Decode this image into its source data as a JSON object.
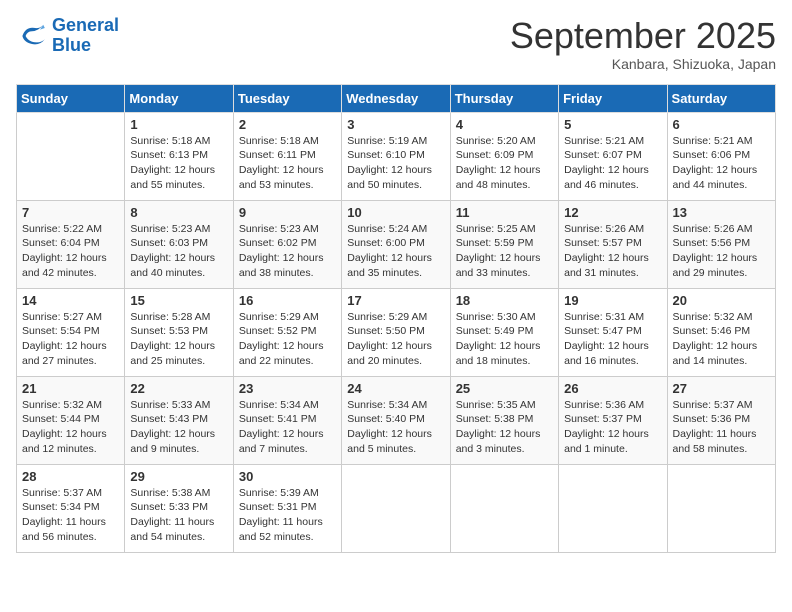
{
  "logo": {
    "text_general": "General",
    "text_blue": "Blue"
  },
  "header": {
    "month": "September 2025",
    "location": "Kanbara, Shizuoka, Japan"
  },
  "days_of_week": [
    "Sunday",
    "Monday",
    "Tuesday",
    "Wednesday",
    "Thursday",
    "Friday",
    "Saturday"
  ],
  "weeks": [
    [
      {
        "day": "",
        "info": ""
      },
      {
        "day": "1",
        "info": "Sunrise: 5:18 AM\nSunset: 6:13 PM\nDaylight: 12 hours\nand 55 minutes."
      },
      {
        "day": "2",
        "info": "Sunrise: 5:18 AM\nSunset: 6:11 PM\nDaylight: 12 hours\nand 53 minutes."
      },
      {
        "day": "3",
        "info": "Sunrise: 5:19 AM\nSunset: 6:10 PM\nDaylight: 12 hours\nand 50 minutes."
      },
      {
        "day": "4",
        "info": "Sunrise: 5:20 AM\nSunset: 6:09 PM\nDaylight: 12 hours\nand 48 minutes."
      },
      {
        "day": "5",
        "info": "Sunrise: 5:21 AM\nSunset: 6:07 PM\nDaylight: 12 hours\nand 46 minutes."
      },
      {
        "day": "6",
        "info": "Sunrise: 5:21 AM\nSunset: 6:06 PM\nDaylight: 12 hours\nand 44 minutes."
      }
    ],
    [
      {
        "day": "7",
        "info": "Sunrise: 5:22 AM\nSunset: 6:04 PM\nDaylight: 12 hours\nand 42 minutes."
      },
      {
        "day": "8",
        "info": "Sunrise: 5:23 AM\nSunset: 6:03 PM\nDaylight: 12 hours\nand 40 minutes."
      },
      {
        "day": "9",
        "info": "Sunrise: 5:23 AM\nSunset: 6:02 PM\nDaylight: 12 hours\nand 38 minutes."
      },
      {
        "day": "10",
        "info": "Sunrise: 5:24 AM\nSunset: 6:00 PM\nDaylight: 12 hours\nand 35 minutes."
      },
      {
        "day": "11",
        "info": "Sunrise: 5:25 AM\nSunset: 5:59 PM\nDaylight: 12 hours\nand 33 minutes."
      },
      {
        "day": "12",
        "info": "Sunrise: 5:26 AM\nSunset: 5:57 PM\nDaylight: 12 hours\nand 31 minutes."
      },
      {
        "day": "13",
        "info": "Sunrise: 5:26 AM\nSunset: 5:56 PM\nDaylight: 12 hours\nand 29 minutes."
      }
    ],
    [
      {
        "day": "14",
        "info": "Sunrise: 5:27 AM\nSunset: 5:54 PM\nDaylight: 12 hours\nand 27 minutes."
      },
      {
        "day": "15",
        "info": "Sunrise: 5:28 AM\nSunset: 5:53 PM\nDaylight: 12 hours\nand 25 minutes."
      },
      {
        "day": "16",
        "info": "Sunrise: 5:29 AM\nSunset: 5:52 PM\nDaylight: 12 hours\nand 22 minutes."
      },
      {
        "day": "17",
        "info": "Sunrise: 5:29 AM\nSunset: 5:50 PM\nDaylight: 12 hours\nand 20 minutes."
      },
      {
        "day": "18",
        "info": "Sunrise: 5:30 AM\nSunset: 5:49 PM\nDaylight: 12 hours\nand 18 minutes."
      },
      {
        "day": "19",
        "info": "Sunrise: 5:31 AM\nSunset: 5:47 PM\nDaylight: 12 hours\nand 16 minutes."
      },
      {
        "day": "20",
        "info": "Sunrise: 5:32 AM\nSunset: 5:46 PM\nDaylight: 12 hours\nand 14 minutes."
      }
    ],
    [
      {
        "day": "21",
        "info": "Sunrise: 5:32 AM\nSunset: 5:44 PM\nDaylight: 12 hours\nand 12 minutes."
      },
      {
        "day": "22",
        "info": "Sunrise: 5:33 AM\nSunset: 5:43 PM\nDaylight: 12 hours\nand 9 minutes."
      },
      {
        "day": "23",
        "info": "Sunrise: 5:34 AM\nSunset: 5:41 PM\nDaylight: 12 hours\nand 7 minutes."
      },
      {
        "day": "24",
        "info": "Sunrise: 5:34 AM\nSunset: 5:40 PM\nDaylight: 12 hours\nand 5 minutes."
      },
      {
        "day": "25",
        "info": "Sunrise: 5:35 AM\nSunset: 5:38 PM\nDaylight: 12 hours\nand 3 minutes."
      },
      {
        "day": "26",
        "info": "Sunrise: 5:36 AM\nSunset: 5:37 PM\nDaylight: 12 hours\nand 1 minute."
      },
      {
        "day": "27",
        "info": "Sunrise: 5:37 AM\nSunset: 5:36 PM\nDaylight: 11 hours\nand 58 minutes."
      }
    ],
    [
      {
        "day": "28",
        "info": "Sunrise: 5:37 AM\nSunset: 5:34 PM\nDaylight: 11 hours\nand 56 minutes."
      },
      {
        "day": "29",
        "info": "Sunrise: 5:38 AM\nSunset: 5:33 PM\nDaylight: 11 hours\nand 54 minutes."
      },
      {
        "day": "30",
        "info": "Sunrise: 5:39 AM\nSunset: 5:31 PM\nDaylight: 11 hours\nand 52 minutes."
      },
      {
        "day": "",
        "info": ""
      },
      {
        "day": "",
        "info": ""
      },
      {
        "day": "",
        "info": ""
      },
      {
        "day": "",
        "info": ""
      }
    ]
  ]
}
